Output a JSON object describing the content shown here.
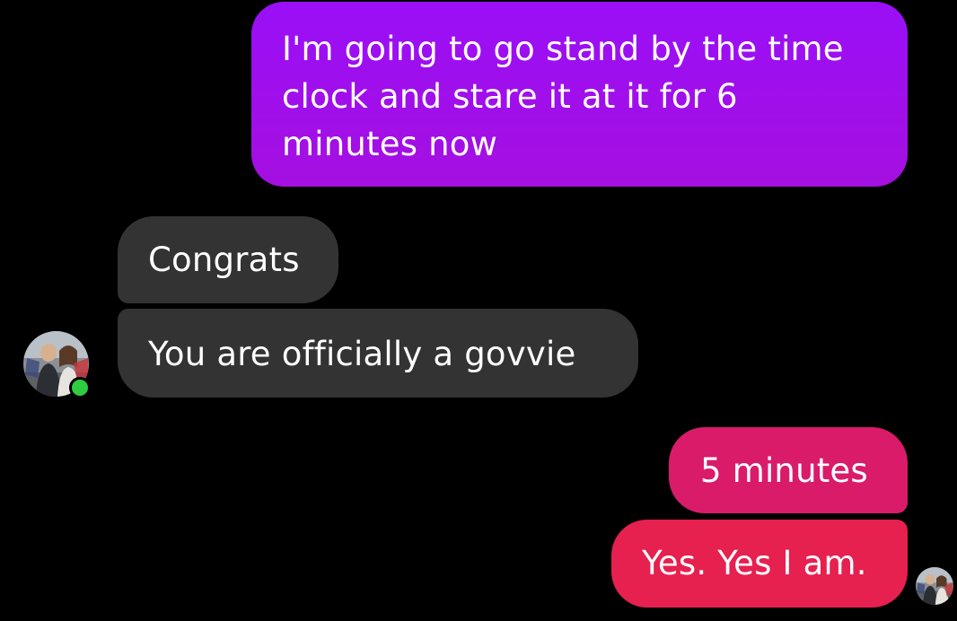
{
  "conversation": {
    "messages": [
      {
        "sender": "me",
        "text": "I'm going to go stand by the time clock and stare it at it for 6 minutes now"
      },
      {
        "sender": "contact",
        "text": "Congrats"
      },
      {
        "sender": "contact",
        "text": "You are officially a govvie"
      },
      {
        "sender": "me",
        "text": "5 minutes"
      },
      {
        "sender": "me",
        "text": "Yes. Yes I am."
      }
    ],
    "contact": {
      "avatar_icon": "contact-avatar",
      "presence": "online",
      "presence_color": "#2ecc40"
    },
    "read_receipt_icon": "read-receipt-avatar"
  },
  "colors": {
    "background": "#000000",
    "incoming_bubble": "#333333",
    "outgoing_purple": "#9a0ff7",
    "outgoing_magenta": "#d91b6a",
    "outgoing_red": "#e6204f",
    "text": "#ffffff"
  }
}
